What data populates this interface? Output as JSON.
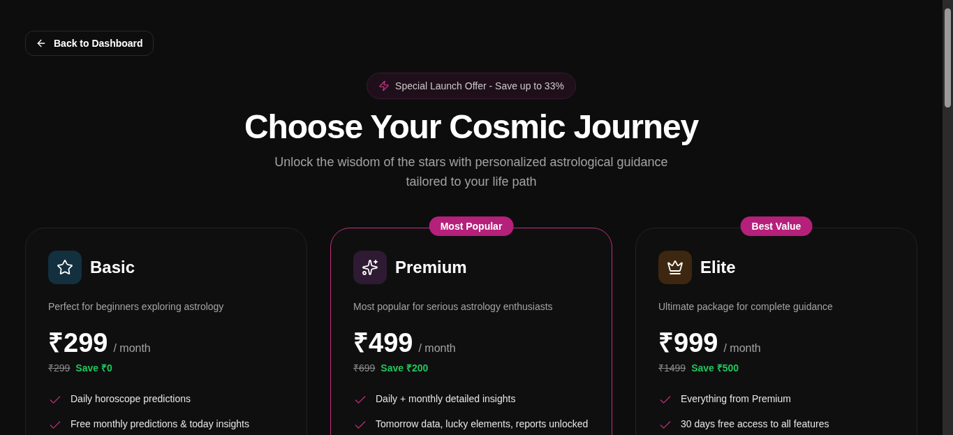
{
  "back_button": {
    "label": "Back to Dashboard"
  },
  "offer_badge": {
    "label": "Special Launch Offer - Save up to 33%"
  },
  "heading": "Choose Your Cosmic Journey",
  "subtitle": "Unlock the wisdom of the stars with personalized astrological guidance tailored to your life path",
  "plans": [
    {
      "kind": "star",
      "color": "#13303f",
      "name": "Basic",
      "highlighted": false,
      "description": "Perfect for beginners exploring astrology",
      "price": "₹299",
      "period": "/ month",
      "original_price": "₹299",
      "savings": "Save ₹0",
      "features": [
        "Daily horoscope predictions",
        "Free monthly predictions & today insights"
      ]
    },
    {
      "kind": "sparkles",
      "color": "#2e1a33",
      "name": "Premium",
      "highlighted": true,
      "badge": "Most Popular",
      "description": "Most popular for serious astrology enthusiasts",
      "price": "₹499",
      "period": "/ month",
      "original_price": "₹699",
      "savings": "Save ₹200",
      "features": [
        "Daily + monthly detailed insights",
        "Tomorrow data, lucky elements, reports unlocked"
      ]
    },
    {
      "kind": "crown",
      "color": "#3d2710",
      "name": "Elite",
      "highlighted": false,
      "badge": "Best Value",
      "description": "Ultimate package for complete guidance",
      "price": "₹999",
      "period": "/ month",
      "original_price": "₹1499",
      "savings": "Save ₹500",
      "features": [
        "Everything from Premium",
        "30 days free access to all features"
      ]
    }
  ]
}
